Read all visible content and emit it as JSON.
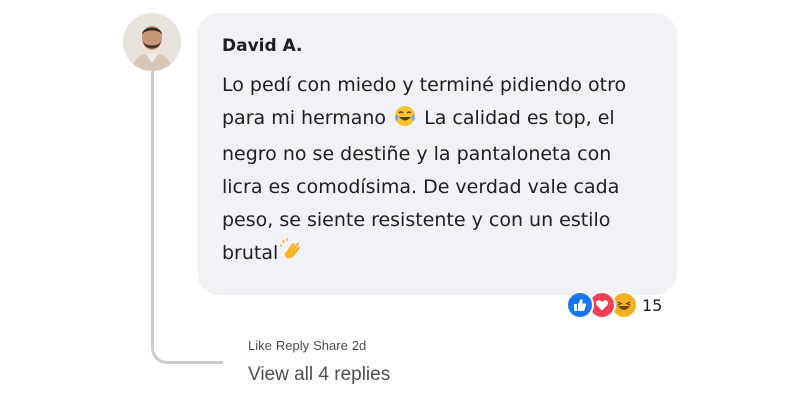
{
  "comment": {
    "author": "David A.",
    "text_lines": [
      "Lo pedí con miedo y terminé pidiendo otro",
      "para mi hermano",
      " La calidad es top, el",
      "negro no se destiñe y la pantaloneta con",
      "licra es comodísima. De verdad vale cada",
      "peso, se siente resistente y con un estilo",
      "brutal"
    ],
    "emojis": [
      "laughing-tears-emoji",
      "clapping-hands-emoji"
    ],
    "avatar_icon": "user-avatar-photo"
  },
  "reactions": {
    "icons": [
      "like-icon",
      "love-icon",
      "haha-icon"
    ],
    "count": "15",
    "colors": {
      "like": "#1877f2",
      "love": "#f33e58",
      "haha": "#f7b125"
    }
  },
  "actions": {
    "like": "Like",
    "reply": "Reply",
    "share": "Share",
    "time": "2d"
  },
  "replies": {
    "view_all": "View all 4 replies"
  },
  "colors": {
    "bubble": "#f0f2f5",
    "thread_line": "#c9ccd1",
    "text": "#1c1e21",
    "muted": "#4b4f56"
  }
}
